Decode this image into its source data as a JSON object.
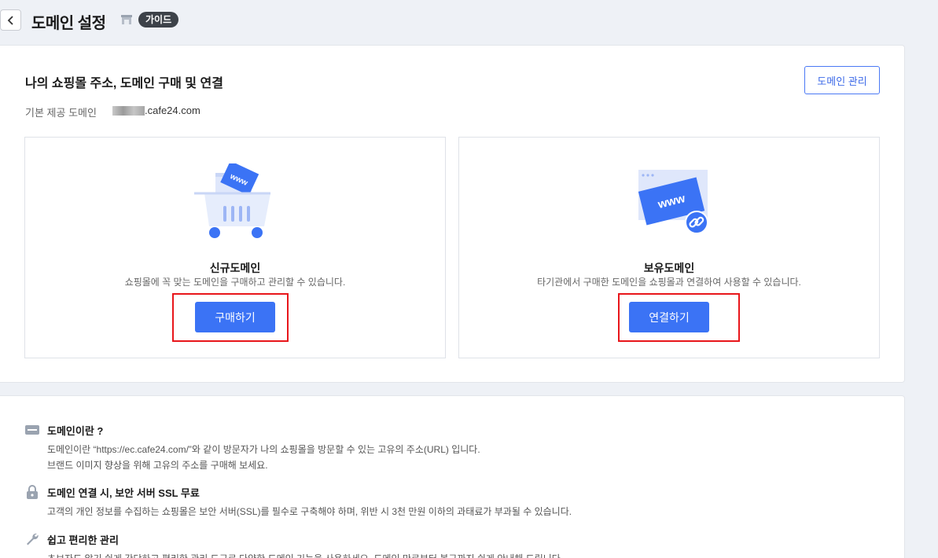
{
  "header": {
    "title": "도메인 설정",
    "guide_label": "가이드"
  },
  "panel": {
    "section_title": "나의 쇼핑몰 주소, 도메인 구매 및 연결",
    "manage_button": "도메인 관리",
    "default_domain_label": "기본 제공 도메인",
    "default_domain_value": ".cafe24.com",
    "cards": [
      {
        "illustration_text": "www",
        "title": "신규도메인",
        "description": "쇼핑몰에 꼭 맞는 도메인을 구매하고 관리할 수 있습니다.",
        "button": "구매하기"
      },
      {
        "illustration_text": "www",
        "title": "보유도메인",
        "description": "타기관에서 구매한 도메인을 쇼핑몰과 연결하여 사용할 수 있습니다.",
        "button": "연결하기"
      }
    ]
  },
  "info": [
    {
      "icon": "domain-icon",
      "title": "도메인이란 ?",
      "lines": [
        "도메인이란 “https://ec.cafe24.com/”와 같이 방문자가 나의 쇼핑몰을 방문할 수 있는 고유의 주소(URL) 입니다.",
        "브랜드 이미지 향상을 위해 고유의 주소를 구매해 보세요."
      ]
    },
    {
      "icon": "lock-icon",
      "title": "도메인 연결 시, 보안 서버 SSL 무료",
      "lines": [
        "고객의 개인 정보를 수집하는 쇼핑몰은 보안 서버(SSL)를 필수로 구축해야 하며, 위반 시 3천 만원 이하의 과태료가 부과될 수 있습니다."
      ]
    },
    {
      "icon": "wrench-icon",
      "title": "쉽고 편리한 관리",
      "lines": [
        "초보자도 알기 쉽게 간단하고 편리한 관리 도구로 다양한 도메인 기능을 사용하세요. 도메인 만료부터 복구까지 쉽게 안내해 드립니다."
      ]
    }
  ],
  "colors": {
    "accent": "#3b73f5",
    "highlight": "#e8161b",
    "background": "#eef1f6"
  }
}
